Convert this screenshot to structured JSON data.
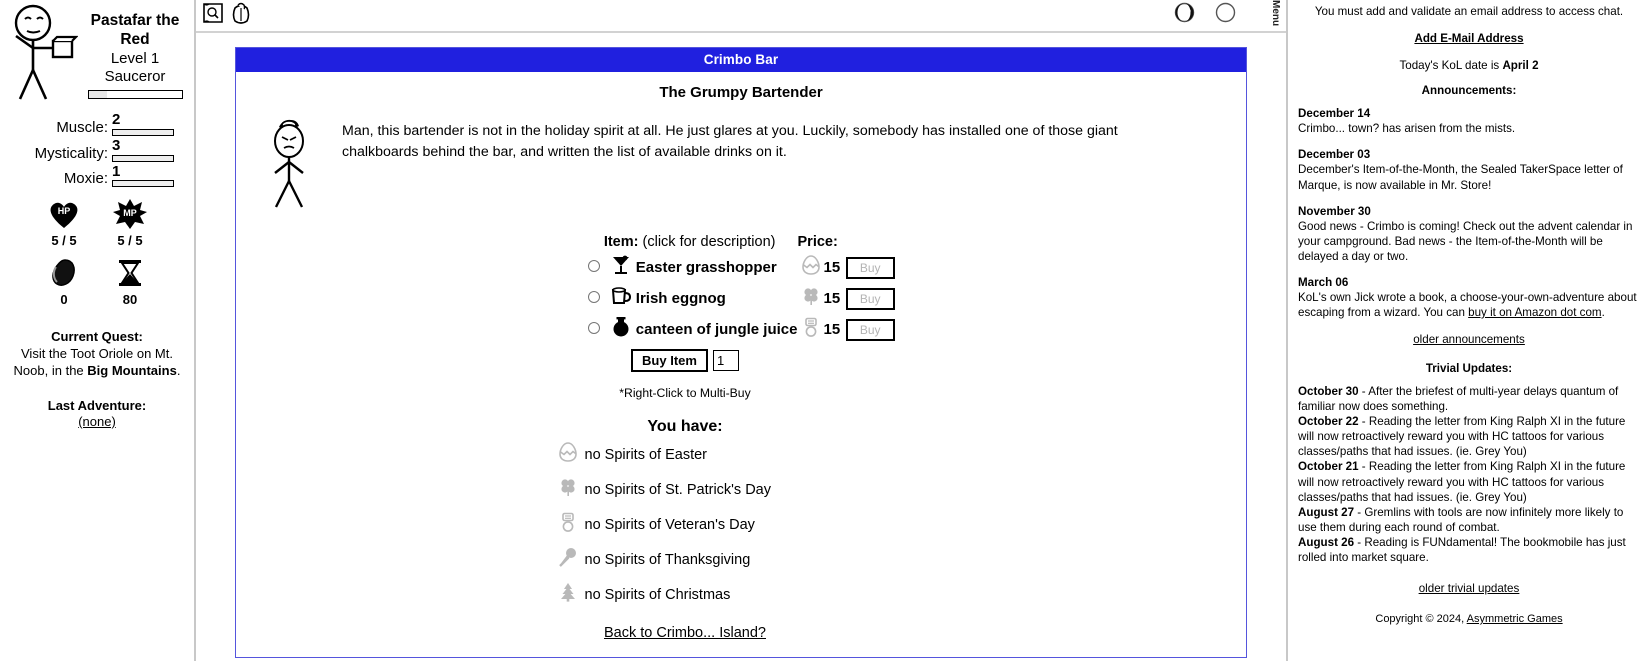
{
  "character": {
    "name": "Pastafar the Red",
    "level": "Level 1",
    "class_name": "Sauceror",
    "stats": [
      {
        "label": "Muscle:",
        "value": "2"
      },
      {
        "label": "Mysticality:",
        "value": "3"
      },
      {
        "label": "Moxie:",
        "value": "1"
      }
    ],
    "hp": {
      "icon": "hp-heart-icon",
      "label": "HP",
      "value": "5 / 5"
    },
    "mp": {
      "icon": "mp-star-icon",
      "label": "MP",
      "value": "5 / 5"
    },
    "meat": {
      "icon": "meat-icon",
      "value": "0"
    },
    "adventures": {
      "icon": "hourglass-icon",
      "value": "80"
    },
    "quest_heading": "Current Quest:",
    "quest_text_1": "Visit the Toot Oriole on Mt. Noob, in the ",
    "quest_text_bold": "Big Mountains",
    "quest_text_2": ".",
    "last_adventure_heading": "Last Adventure:",
    "last_adventure_value": "(none)"
  },
  "topbar": {
    "map_icon": "map-icon",
    "inventory_icon": "backpack-icon",
    "moon1_icon": "moon-phase-gibbous-icon",
    "moon2_icon": "moon-phase-new-icon",
    "vertical_label": "Menu"
  },
  "panel": {
    "title": "Crimbo Bar",
    "bartender_heading": "The Grumpy Bartender",
    "bartender_image": "grumpy-bartender-stickfigure",
    "bartender_text": "Man, this bartender is not in the holiday spirit at all. He just glares at you. Luckily, somebody has installed one of those giant chalkboards behind the bar, and written the list of available drinks on it."
  },
  "shop": {
    "header_item": "Item:",
    "header_item_sub": " (click for description)",
    "header_price": "Price:",
    "items": [
      {
        "icon": "cocktail-glass-icon",
        "name": "Easter grasshopper",
        "currency_icon": "cracked-egg-icon",
        "price": "15",
        "buy_label": "Buy"
      },
      {
        "icon": "mug-icon",
        "name": "Irish eggnog",
        "currency_icon": "shamrock-icon",
        "price": "15",
        "buy_label": "Buy"
      },
      {
        "icon": "canteen-icon",
        "name": "canteen of jungle juice",
        "currency_icon": "dogtag-icon",
        "price": "15",
        "buy_label": "Buy"
      }
    ],
    "buy_item_label": "Buy Item",
    "quantity_value": "1",
    "multibuy_note": "*Right-Click to Multi-Buy"
  },
  "inventory": {
    "heading": "You have:",
    "rows": [
      {
        "icon": "cracked-egg-icon",
        "text": "no Spirits of Easter"
      },
      {
        "icon": "shamrock-icon",
        "text": "no Spirits of St. Patrick's Day"
      },
      {
        "icon": "dogtag-icon",
        "text": "no Spirits of Veteran's Day"
      },
      {
        "icon": "turkey-leg-icon",
        "text": "no Spirits of Thanksgiving"
      },
      {
        "icon": "christmas-tree-icon",
        "text": "no Spirits of Christmas"
      }
    ]
  },
  "back_link": "Back to Crimbo... Island?",
  "rightpane": {
    "chat_notice": "You must add and validate an email address to access chat.",
    "add_email_link": "Add E-Mail Address",
    "kol_date_prefix": "Today's KoL date is ",
    "kol_date_value": "April 2",
    "announcements_heading": "Announcements:",
    "announcements": [
      {
        "date": "December 14",
        "body": "Crimbo... town? has arisen from the mists."
      },
      {
        "date": "December 03",
        "body": "December's Item-of-the-Month, the Sealed TakerSpace letter of Marque, is now available in Mr. Store!"
      },
      {
        "date": "November 30",
        "body": "Good news - Crimbo is coming! Check out the advent calendar in your campground. Bad news - the Item-of-the-Month will be delayed a day or two."
      }
    ],
    "march_date": "March 06",
    "march_body_1": "KoL's own Jick wrote a book, a choose-your-own-adventure about escaping from a wizard. You can ",
    "march_link": "buy it on Amazon dot com",
    "march_body_2": ".",
    "older_announcements": "older announcements",
    "trivial_heading": "Trivial Updates:",
    "trivial_updates": [
      {
        "date": "October 30",
        "body": " - After the briefest of multi-year delays quantum of familiar now does something."
      },
      {
        "date": "October 22",
        "body": " - Reading the letter from King Ralph XI in the future will now retroactively reward you with HC tattoos for various classes/paths that had issues. (ie. Grey You)"
      },
      {
        "date": "October 21",
        "body": " - Reading the letter from King Ralph XI in the future will now retroactively reward you with HC tattoos for various classes/paths that had issues. (ie. Grey You)"
      },
      {
        "date": "August 27",
        "body": " - Gremlins with tools are now infinitely more likely to use them during each round of combat."
      },
      {
        "date": "August 26",
        "body": " - Reading is FUNdamental! The bookmobile has just rolled into market square."
      }
    ],
    "older_trivial": "older trivial updates",
    "copyright_prefix": "Copyright © 2024, ",
    "copyright_link": "Asymmetric Games"
  },
  "colors": {
    "panel_header_bg": "#2020df",
    "panel_border": "#5555dd",
    "divider": "#c8c8c8"
  }
}
